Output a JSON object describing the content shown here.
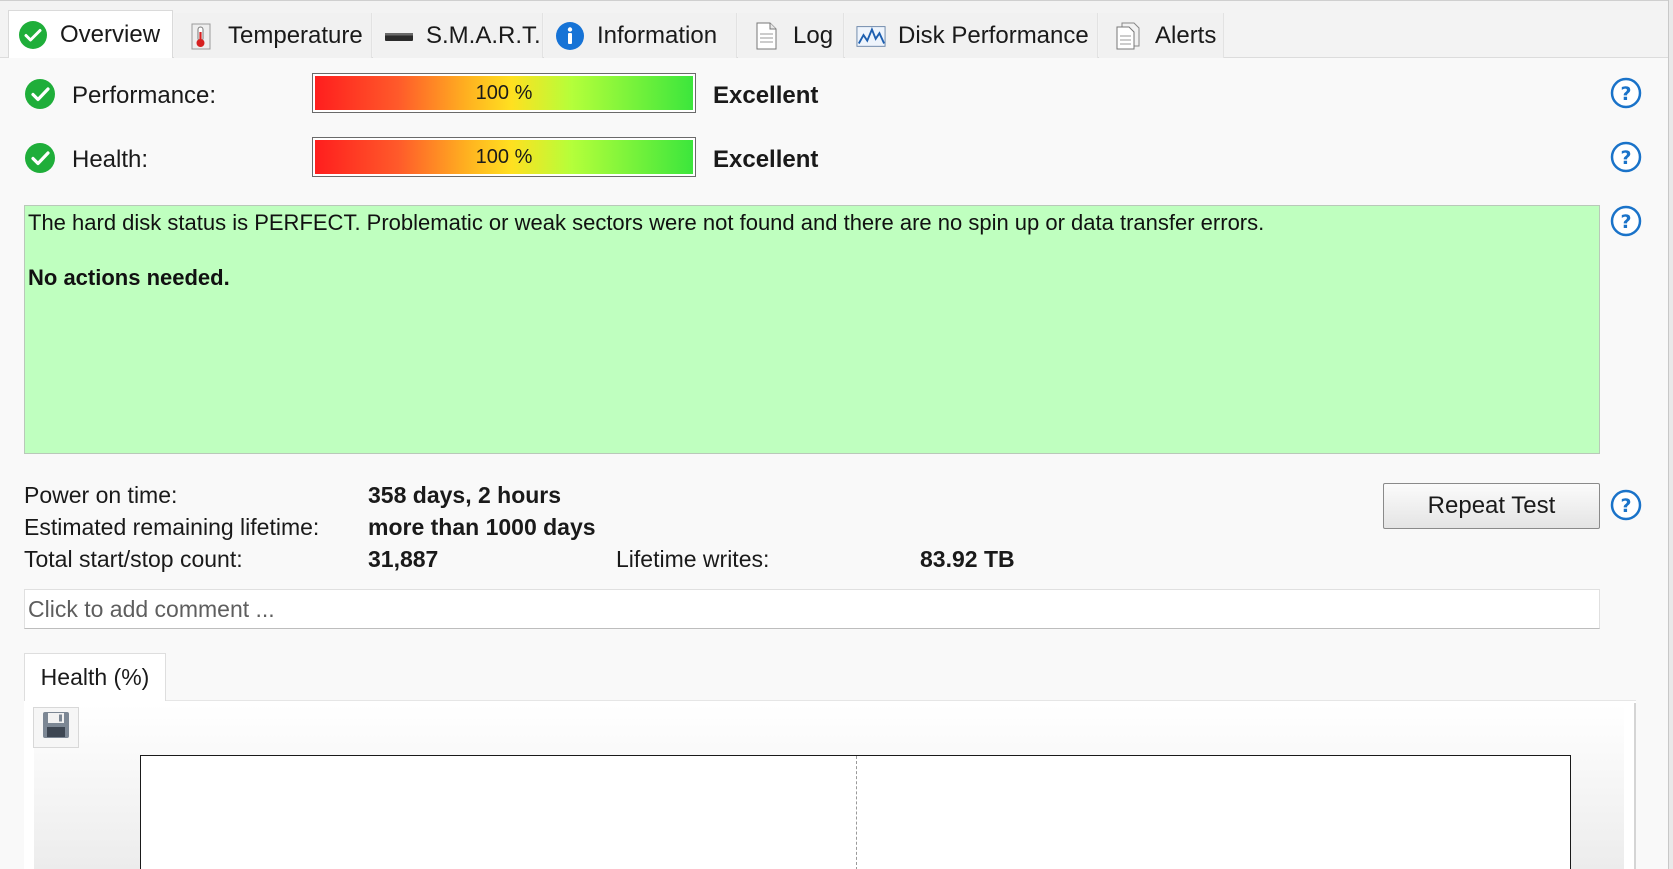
{
  "tabs": [
    {
      "label": "Overview",
      "icon": "check-circle-icon",
      "active": true
    },
    {
      "label": "Temperature",
      "icon": "thermometer-icon",
      "active": false
    },
    {
      "label": "S.M.A.R.T.",
      "icon": "drive-icon",
      "active": false
    },
    {
      "label": "Information",
      "icon": "info-icon",
      "active": false
    },
    {
      "label": "Log",
      "icon": "document-icon",
      "active": false
    },
    {
      "label": "Disk Performance",
      "icon": "performance-chart-icon",
      "active": false
    },
    {
      "label": "Alerts",
      "icon": "alerts-document-icon",
      "active": false
    }
  ],
  "performance": {
    "label": "Performance:",
    "value_text": "100 %",
    "value": 100,
    "rating": "Excellent"
  },
  "health": {
    "label": "Health:",
    "value_text": "100 %",
    "value": 100,
    "rating": "Excellent"
  },
  "status": {
    "message": "The hard disk status is PERFECT. Problematic or weak sectors were not found and there are no spin up or data transfer errors.",
    "action": "No actions needed."
  },
  "stats": {
    "power_on_label": "Power on time:",
    "power_on_value": "358 days, 2 hours",
    "lifetime_label": "Estimated remaining lifetime:",
    "lifetime_value": "more than 1000 days",
    "startstop_label": "Total start/stop count:",
    "startstop_value": "31,887",
    "writes_label": "Lifetime writes:",
    "writes_value": "83.92 TB"
  },
  "repeat_test_label": "Repeat Test",
  "comment": {
    "placeholder": "Click to add comment ...",
    "value": ""
  },
  "chart_tab_label": "Health (%)",
  "colors": {
    "status_bg": "#bfffbf",
    "ok_green": "#1fae3a",
    "help_blue": "#1a73c9",
    "bar_red": "#ff1e1e",
    "bar_green": "#3ce63c"
  }
}
